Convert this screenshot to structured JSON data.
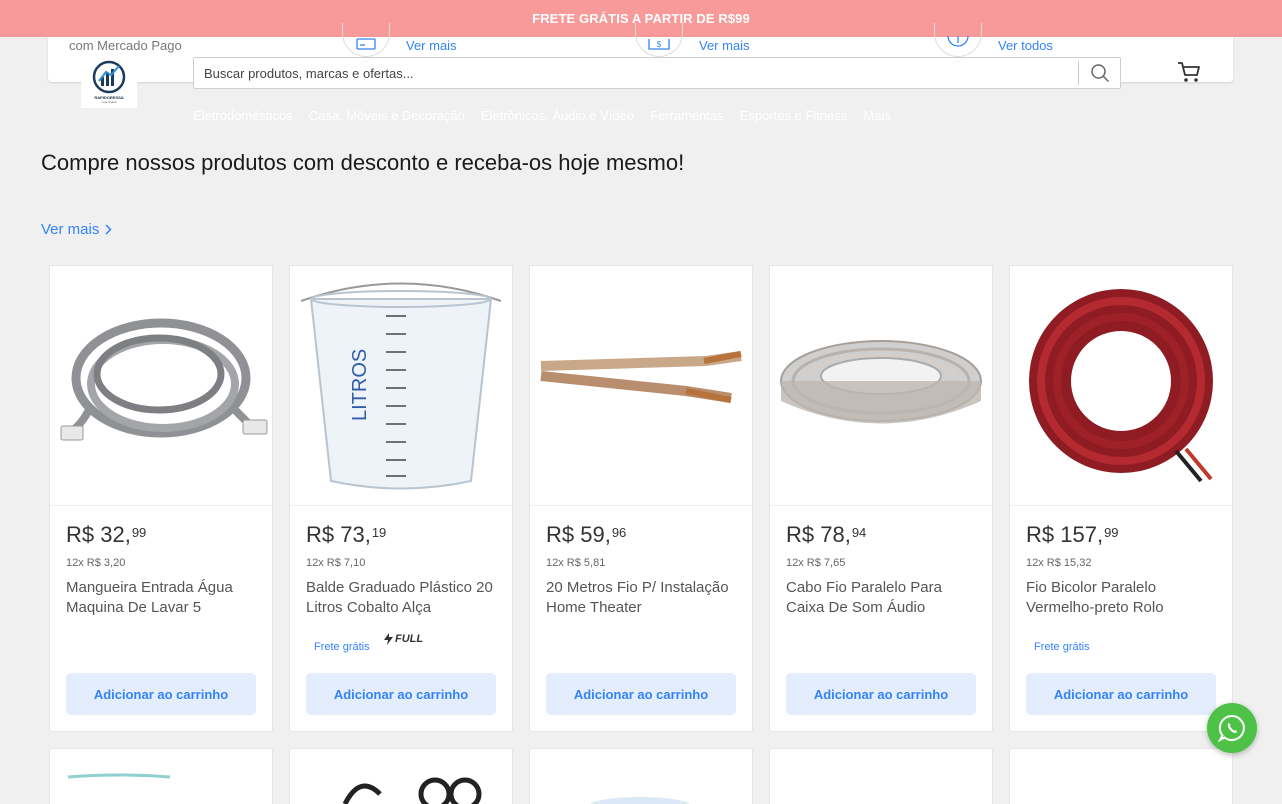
{
  "promo": {
    "text": "FRETE GRÁTIS A PARTIR DE R$99"
  },
  "header": {
    "payment_text": "com Mercado Pago",
    "links": [
      "Ver mais",
      "Ver mais",
      "Ver todos"
    ]
  },
  "logo": {
    "name": "RAPIDORESSA",
    "tagline": "Loja Digital"
  },
  "search": {
    "placeholder": "Buscar produtos, marcas e ofertas..."
  },
  "categories": [
    "Eletrodomésticos",
    "Casa, Móveis e Decoração",
    "Eletrônicos, Áudio e Vídeo",
    "Ferramentas",
    "Esportes e Fitness",
    "Mais"
  ],
  "section": {
    "headline": "Compre nossos produtos com desconto e receba-os hoje mesmo!",
    "more_link": "Ver mais"
  },
  "products": [
    {
      "price": "R$ 32,",
      "cents": "99",
      "installment": "12x R$ 3,20",
      "title": "Mangueira Entrada Água Maquina De Lavar 5",
      "free_shipping": "",
      "full": "",
      "button": "Adicionar ao carrinho",
      "image": "hose-image"
    },
    {
      "price": "R$ 73,",
      "cents": "19",
      "installment": "12x R$ 7,10",
      "title": "Balde Graduado Plástico 20 Litros Cobalto Alça",
      "free_shipping": "Frete grátis",
      "full": "FULL",
      "button": "Adicionar ao carrinho",
      "image": "bucket-image"
    },
    {
      "price": "R$ 59,",
      "cents": "96",
      "installment": "12x R$ 5,81",
      "title": "20 Metros Fio P/ Instalação Home Theater",
      "free_shipping": "",
      "full": "",
      "button": "Adicionar ao carrinho",
      "image": "wire-image"
    },
    {
      "price": "R$ 78,",
      "cents": "94",
      "installment": "12x R$ 7,65",
      "title": "Cabo Fio Paralelo Para Caixa De Som Áudio",
      "free_shipping": "",
      "full": "",
      "button": "Adicionar ao carrinho",
      "image": "cable-coil-image"
    },
    {
      "price": "R$ 157,",
      "cents": "99",
      "installment": "12x R$ 15,32",
      "title": "Fio Bicolor Paralelo Vermelho-preto Rolo",
      "free_shipping": "Frete grátis",
      "full": "",
      "button": "Adicionar ao carrinho",
      "image": "red-cable-image"
    }
  ],
  "colors": {
    "promo": "#f99a9a",
    "link": "#3483fa",
    "button_bg": "#e3edfb",
    "whatsapp": "#4dc247"
  }
}
